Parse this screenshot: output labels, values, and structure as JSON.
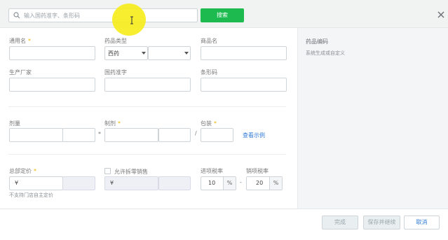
{
  "search": {
    "placeholder": "输入国药准字、条形码",
    "button_label": "搜索"
  },
  "right_panel": {
    "title": "药品编码",
    "subtitle": "系统生成或自定义"
  },
  "form": {
    "generic_name_label": "通用名",
    "drug_type_label": "药品类型",
    "drug_type_value": "西药",
    "trade_name_label": "商品名",
    "manufacturer_label": "生产厂家",
    "approval_no_label": "国药准字",
    "barcode_label": "条形码",
    "dosage_label": "剂量",
    "times_sign": "*",
    "formulation_label": "制剂",
    "slash_sign": "/",
    "package_label": "包装",
    "view_example_link": "查看示例",
    "total_price_label": "总部定价",
    "currency_symbol": "¥",
    "currency_symbol_2": "¥",
    "no_store_pricing_hint": "不支持门店自主定价",
    "allow_split_label": "允许拆零销售",
    "purchase_tax_label": "进项税率",
    "purchase_tax_value": "10",
    "percent_unit": "%",
    "dash_sign": "-",
    "sales_tax_label": "销项税率",
    "sales_tax_value": "20",
    "percent_unit_2": "%",
    "required_mark": "*"
  },
  "footer": {
    "done_label": "完成",
    "save_continue_label": "保存并继续",
    "cancel_label": "取消"
  },
  "colors": {
    "primary_green": "#1dbb4f",
    "link_blue": "#2f7ad6",
    "required_yellow": "#e4b800",
    "cursor_highlight": "#f6ec1a"
  },
  "icons": [
    "search-icon",
    "close-icon",
    "chevron-down-icon",
    "text-cursor-icon"
  ]
}
